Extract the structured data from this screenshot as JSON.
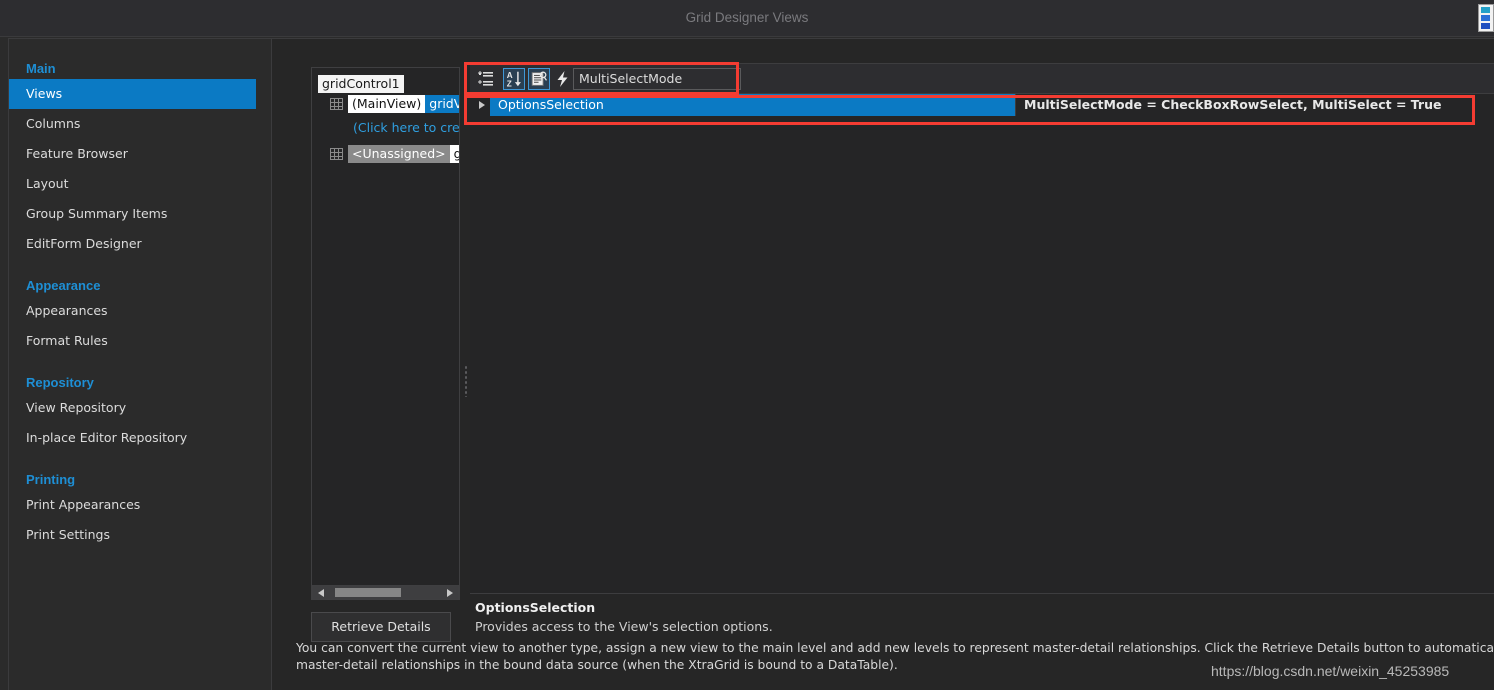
{
  "window": {
    "title": "Grid Designer Views",
    "corner_icon": "app-icon"
  },
  "sidebar": {
    "groups": [
      {
        "title": "Main",
        "items": [
          {
            "label": "Views",
            "selected": true
          },
          {
            "label": "Columns",
            "selected": false
          },
          {
            "label": "Feature Browser",
            "selected": false
          },
          {
            "label": "Layout",
            "selected": false
          },
          {
            "label": "Group Summary Items",
            "selected": false
          },
          {
            "label": "EditForm Designer",
            "selected": false
          }
        ]
      },
      {
        "title": "Appearance",
        "items": [
          {
            "label": "Appearances",
            "selected": false
          },
          {
            "label": "Format Rules",
            "selected": false
          }
        ]
      },
      {
        "title": "Repository",
        "items": [
          {
            "label": "View Repository",
            "selected": false
          },
          {
            "label": "In-place Editor Repository",
            "selected": false
          }
        ]
      },
      {
        "title": "Printing",
        "items": [
          {
            "label": "Print Appearances",
            "selected": false
          },
          {
            "label": "Print Settings",
            "selected": false
          }
        ]
      }
    ]
  },
  "tree": {
    "root": "gridControl1",
    "main_view_label": "(MainView)",
    "main_view_name": "gridVie",
    "create_link": "(Click here to create",
    "unassigned_label": "<Unassigned>",
    "unassigned_name": "grid",
    "retrieve_button": "Retrieve Details"
  },
  "property_grid": {
    "toolbar": {
      "categorized_icon": "categorized-list-icon",
      "alphabetical_icon": "sort-alphabetical-icon",
      "property_pages_icon": "property-pages-icon",
      "events_icon": "lightning-bolt-icon",
      "search_value": "MultiSelectMode",
      "search_placeholder": ""
    },
    "rows": [
      {
        "name": "OptionsSelection",
        "value": "MultiSelectMode = CheckBoxRowSelect, MultiSelect = True",
        "selected": true,
        "expanded": false
      }
    ]
  },
  "description": {
    "title": "OptionsSelection",
    "text": "Provides access to the View's selection options."
  },
  "footer": {
    "help_text": "You can convert the current view to another type, assign a new view to the main level and add new levels to represent master-detail relationships. Click the Retrieve Details button to automatically create levels for all t",
    "help_text_line2": "master-detail relationships in the bound data source (when the XtraGrid is bound to a DataTable).",
    "watermark": "https://blog.csdn.net/weixin_45253985"
  },
  "colors": {
    "accent": "#0b7ac4",
    "group_title": "#1e8fd5",
    "annotation": "#f43c32",
    "background": "#262626"
  }
}
